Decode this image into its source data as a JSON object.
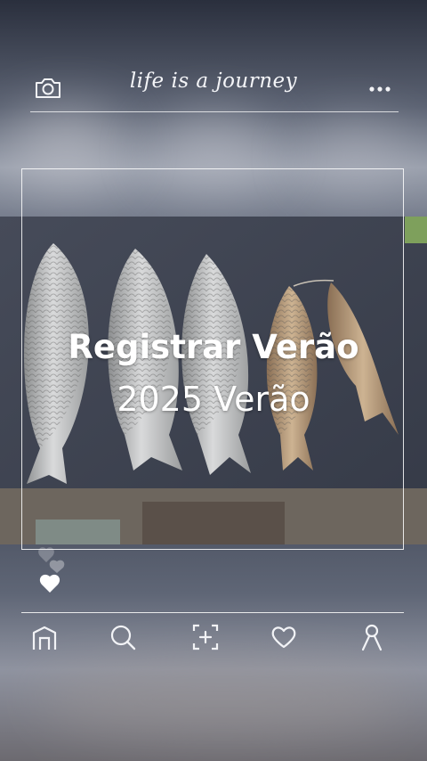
{
  "header": {
    "brand_text": "life is a journey",
    "camera_icon": "camera-icon",
    "more_icon": "more-horizontal-icon"
  },
  "post": {
    "title": "Registrar Verão",
    "subtitle": "2025 Verão"
  },
  "reactions": {
    "icon": "heart-icon"
  },
  "nav": {
    "items": [
      {
        "icon": "home-icon"
      },
      {
        "icon": "search-icon"
      },
      {
        "icon": "add-post-icon"
      },
      {
        "icon": "heart-outline-icon"
      },
      {
        "icon": "profile-icon"
      }
    ]
  },
  "colors": {
    "accent": "#ffffff",
    "background_dark": "#3e4453",
    "board": "#3b4150"
  }
}
